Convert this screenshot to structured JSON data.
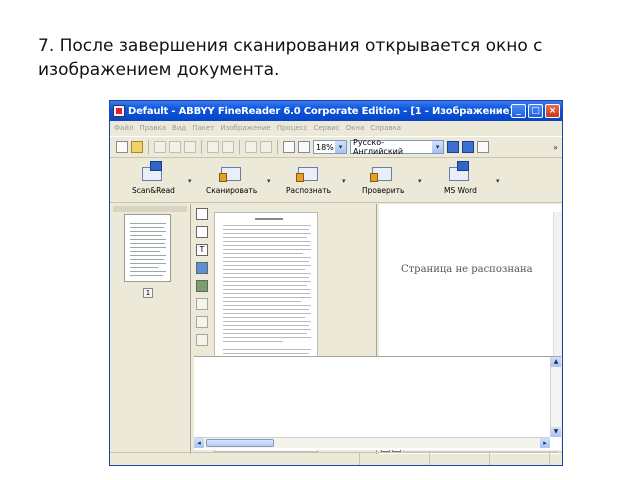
{
  "caption": "7. После завершения сканирования открывается окно с изображением документа.",
  "window": {
    "title": "Default - ABBYY FineReader 6.0 Corporate Edition - [1 - Изображение]",
    "controls": {
      "minimize": "_",
      "maximize": "□",
      "close": "×"
    }
  },
  "menu": [
    "Файл",
    "Правка",
    "Вид",
    "Пакет",
    "Изображение",
    "Процесс",
    "Сервис",
    "Окна",
    "Справка"
  ],
  "toolbar": {
    "zoom": "18%",
    "language": "Русско-Английский",
    "overflow": "»"
  },
  "big_buttons": [
    {
      "label": "Scan&Read",
      "icon": "scan-read-icon"
    },
    {
      "label": "Сканировать",
      "icon": "scanner-icon"
    },
    {
      "label": "Распознать",
      "icon": "recognize-icon"
    },
    {
      "label": "Проверить",
      "icon": "check-icon"
    },
    {
      "label": "MS Word",
      "icon": "ms-word-icon"
    }
  ],
  "dropdown_glyph": "▾",
  "thumbnail": {
    "page_number": "1"
  },
  "text_pane": {
    "message": "Страница не распознана"
  },
  "colors": {
    "title_blue": "#0a55e0",
    "chrome": "#ece9d8"
  }
}
